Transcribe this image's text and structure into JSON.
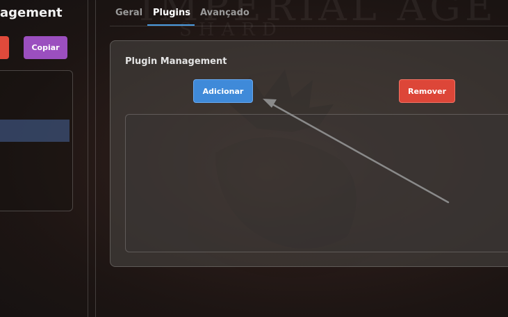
{
  "background": {
    "watermark_title": "IMPERIAL AGE",
    "watermark_subtitle": "SHARD"
  },
  "left_panel": {
    "title": "agement",
    "copy_button": "Copiar",
    "list_selected_index": 2
  },
  "tabs": [
    {
      "label": "Geral",
      "active": false
    },
    {
      "label": "Plugins",
      "active": true
    },
    {
      "label": "Avançado",
      "active": false
    }
  ],
  "plugin_card": {
    "title": "Plugin Management",
    "add_button": "Adicionar",
    "remove_button": "Remover"
  },
  "colors": {
    "accent_blue": "#3f8ad9",
    "danger_red": "#dd4638",
    "purple": "#9b4fbf",
    "tab_underline": "#4a9be0"
  },
  "annotation": {
    "type": "arrow",
    "points_to": "add-plugin-button"
  }
}
